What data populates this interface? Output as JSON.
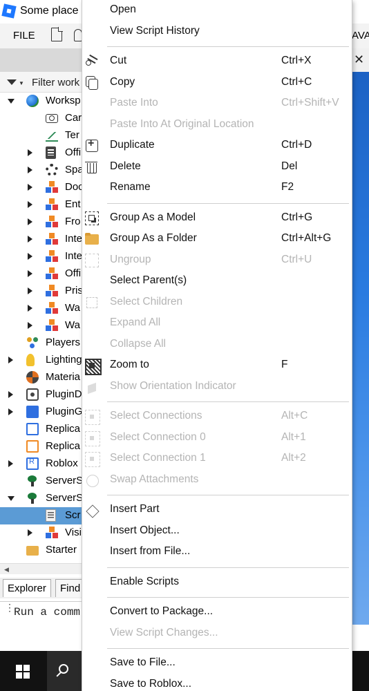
{
  "window": {
    "title": "Some place"
  },
  "menubar": {
    "file_label": "FILE",
    "right_fragment": "AVA"
  },
  "explorer": {
    "filter_placeholder": "Filter work",
    "tree": [
      {
        "label": "Worksp",
        "icon": "globe-icon",
        "depth": 0,
        "state": "expanded"
      },
      {
        "label": "Car",
        "icon": "camera-icon",
        "depth": 1,
        "state": "none"
      },
      {
        "label": "Ter",
        "icon": "terrain-icon",
        "depth": 1,
        "state": "none"
      },
      {
        "label": "Offi",
        "icon": "script-icon",
        "depth": 1,
        "state": "collapsed"
      },
      {
        "label": "Spa",
        "icon": "gear-icon",
        "depth": 1,
        "state": "collapsed"
      },
      {
        "label": "Doc",
        "icon": "model-icon",
        "depth": 1,
        "state": "collapsed"
      },
      {
        "label": "Ent",
        "icon": "model-icon",
        "depth": 1,
        "state": "collapsed"
      },
      {
        "label": "Fro",
        "icon": "model-icon",
        "depth": 1,
        "state": "collapsed"
      },
      {
        "label": "Inte",
        "icon": "model-icon",
        "depth": 1,
        "state": "collapsed"
      },
      {
        "label": "Inte",
        "icon": "model-icon",
        "depth": 1,
        "state": "collapsed"
      },
      {
        "label": "Offi",
        "icon": "model-icon",
        "depth": 1,
        "state": "collapsed"
      },
      {
        "label": "Pris",
        "icon": "model-icon",
        "depth": 1,
        "state": "collapsed"
      },
      {
        "label": "Wa",
        "icon": "model-icon",
        "depth": 1,
        "state": "collapsed"
      },
      {
        "label": "Wa",
        "icon": "model-icon",
        "depth": 1,
        "state": "collapsed"
      },
      {
        "label": "Players",
        "icon": "players-icon",
        "depth": 0,
        "state": "none"
      },
      {
        "label": "Lighting",
        "icon": "lightbulb-icon",
        "depth": 0,
        "state": "collapsed"
      },
      {
        "label": "Materia",
        "icon": "material-icon",
        "depth": 0,
        "state": "none"
      },
      {
        "label": "PluginD",
        "icon": "box-icon",
        "depth": 0,
        "state": "collapsed"
      },
      {
        "label": "PluginG",
        "icon": "plugin-icon",
        "depth": 0,
        "state": "collapsed"
      },
      {
        "label": "Replica",
        "icon": "replicated-first-icon",
        "depth": 0,
        "state": "none"
      },
      {
        "label": "Replica",
        "icon": "replicated-storage-icon",
        "depth": 0,
        "state": "none"
      },
      {
        "label": "Roblox",
        "icon": "roblox-icon",
        "depth": 0,
        "state": "collapsed"
      },
      {
        "label": "ServerS",
        "icon": "server-tree-icon",
        "depth": 0,
        "state": "none"
      },
      {
        "label": "ServerS",
        "icon": "server-tree-icon",
        "depth": 0,
        "state": "expanded"
      },
      {
        "label": "Scr",
        "icon": "script-file-icon",
        "depth": 1,
        "state": "none",
        "selected": true
      },
      {
        "label": "Visi",
        "icon": "model-icon",
        "depth": 1,
        "state": "collapsed"
      },
      {
        "label": "Starter",
        "icon": "folder-icon",
        "depth": 0,
        "state": "none"
      }
    ],
    "tabs": {
      "explorer": "Explorer",
      "find": "Find"
    }
  },
  "command_bar": {
    "placeholder": "Run a comm"
  },
  "context_menu": {
    "items": [
      {
        "label": "Open",
        "shortcut": "",
        "enabled": true,
        "icon": ""
      },
      {
        "label": "View Script History",
        "shortcut": "",
        "enabled": true,
        "icon": ""
      },
      {
        "separator": true
      },
      {
        "label": "Cut",
        "shortcut": "Ctrl+X",
        "enabled": true,
        "icon": "scissors-icon"
      },
      {
        "label": "Copy",
        "shortcut": "Ctrl+C",
        "enabled": true,
        "icon": "copy-icon"
      },
      {
        "label": "Paste Into",
        "shortcut": "Ctrl+Shift+V",
        "enabled": false,
        "icon": ""
      },
      {
        "label": "Paste Into At Original Location",
        "shortcut": "",
        "enabled": false,
        "icon": ""
      },
      {
        "label": "Duplicate",
        "shortcut": "Ctrl+D",
        "enabled": true,
        "icon": "duplicate-icon"
      },
      {
        "label": "Delete",
        "shortcut": "Del",
        "enabled": true,
        "icon": "trash-icon"
      },
      {
        "label": "Rename",
        "shortcut": "F2",
        "enabled": true,
        "icon": ""
      },
      {
        "separator": true
      },
      {
        "label": "Group As a Model",
        "shortcut": "Ctrl+G",
        "enabled": true,
        "icon": "group-model-icon"
      },
      {
        "label": "Group As a Folder",
        "shortcut": "Ctrl+Alt+G",
        "enabled": true,
        "icon": "folder-icon"
      },
      {
        "label": "Ungroup",
        "shortcut": "Ctrl+U",
        "enabled": false,
        "icon": "ungroup-icon"
      },
      {
        "label": "Select Parent(s)",
        "shortcut": "",
        "enabled": true,
        "icon": ""
      },
      {
        "label": "Select Children",
        "shortcut": "",
        "enabled": false,
        "icon": "select-children-icon"
      },
      {
        "label": "Expand All",
        "shortcut": "",
        "enabled": false,
        "icon": ""
      },
      {
        "label": "Collapse All",
        "shortcut": "",
        "enabled": false,
        "icon": ""
      },
      {
        "label": "Zoom to",
        "shortcut": "F",
        "enabled": true,
        "icon": "zoom-to-icon"
      },
      {
        "label": "Show Orientation Indicator",
        "shortcut": "",
        "enabled": false,
        "icon": "orientation-icon"
      },
      {
        "separator": true
      },
      {
        "label": "Select Connections",
        "shortcut": "Alt+C",
        "enabled": false,
        "icon": "connection-icon"
      },
      {
        "label": "Select Connection 0",
        "shortcut": "Alt+1",
        "enabled": false,
        "icon": "connection-icon"
      },
      {
        "label": "Select Connection 1",
        "shortcut": "Alt+2",
        "enabled": false,
        "icon": "connection-icon"
      },
      {
        "label": "Swap Attachments",
        "shortcut": "",
        "enabled": false,
        "icon": "swap-icon"
      },
      {
        "separator": true
      },
      {
        "label": "Insert Part",
        "shortcut": "",
        "enabled": true,
        "icon": "part-icon"
      },
      {
        "label": "Insert Object...",
        "shortcut": "",
        "enabled": true,
        "icon": ""
      },
      {
        "label": "Insert from File...",
        "shortcut": "",
        "enabled": true,
        "icon": ""
      },
      {
        "separator": true
      },
      {
        "label": "Enable Scripts",
        "shortcut": "",
        "enabled": true,
        "icon": ""
      },
      {
        "separator": true
      },
      {
        "label": "Convert to Package...",
        "shortcut": "",
        "enabled": true,
        "icon": ""
      },
      {
        "label": "View Script Changes...",
        "shortcut": "",
        "enabled": false,
        "icon": ""
      },
      {
        "separator": true
      },
      {
        "label": "Save to File...",
        "shortcut": "",
        "enabled": true,
        "icon": ""
      },
      {
        "label": "Save to Roblox...",
        "shortcut": "",
        "enabled": true,
        "icon": ""
      }
    ]
  },
  "colors": {
    "selection": "#5b9bd5",
    "disabled_text": "#b4b4b4",
    "taskbar": "#121212",
    "viewport_sky": "#2a7be0"
  }
}
